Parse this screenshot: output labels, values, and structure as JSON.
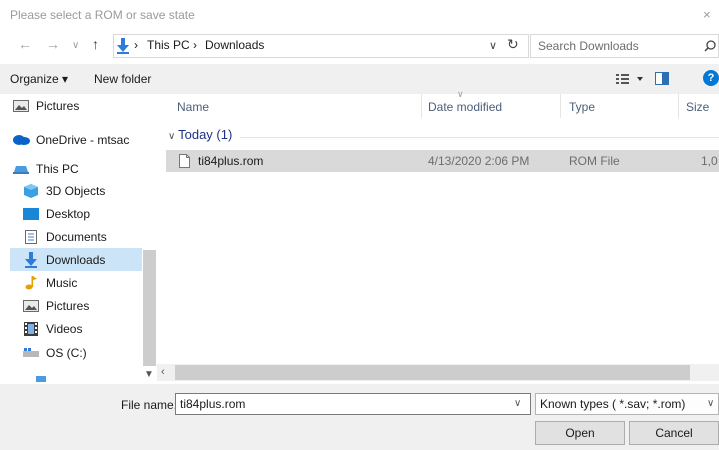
{
  "window": {
    "title": "Please select a ROM or save state",
    "close_glyph": "×"
  },
  "address_bar": {
    "crumbs": [
      "This PC",
      "Downloads"
    ],
    "separator": "›",
    "dropdown_glyph": "∨",
    "refresh_glyph": "↻"
  },
  "search": {
    "placeholder": "Search Downloads"
  },
  "toolbar": {
    "organize_label": "Organize ▾",
    "new_folder_label": "New folder",
    "help_label": "?"
  },
  "nav_pane": {
    "items": [
      {
        "label": "Pictures",
        "icon": "pictures-icon"
      },
      {
        "label": "OneDrive - mtsac",
        "icon": "onedrive-cloud-icon"
      },
      {
        "label": "This PC",
        "icon": "computer-icon"
      },
      {
        "label": "3D Objects",
        "icon": "3d-objects-icon"
      },
      {
        "label": "Desktop",
        "icon": "desktop-icon"
      },
      {
        "label": "Documents",
        "icon": "documents-icon"
      },
      {
        "label": "Downloads",
        "icon": "downloads-icon",
        "selected": true
      },
      {
        "label": "Music",
        "icon": "music-icon"
      },
      {
        "label": "Pictures",
        "icon": "pictures-icon"
      },
      {
        "label": "Videos",
        "icon": "videos-icon"
      },
      {
        "label": "OS (C:)",
        "icon": "drive-icon"
      }
    ]
  },
  "file_list": {
    "columns": [
      "Name",
      "Date modified",
      "Type",
      "Size"
    ],
    "group": "Today (1)",
    "rows": [
      {
        "name": "ti84plus.rom",
        "date_modified": "4/13/2020 2:06 PM",
        "type": "ROM File",
        "size": "1,0"
      }
    ]
  },
  "bottom": {
    "file_name_label": "File name:",
    "file_name_value": "ti84plus.rom",
    "file_type_value": "Known types ( *.sav; *.rom)",
    "open_label": "Open",
    "cancel_label": "Cancel"
  },
  "colors": {
    "selection": "#cce4f7",
    "row_highlight": "#d9d9d9",
    "accent_blue": "#0078d7"
  }
}
